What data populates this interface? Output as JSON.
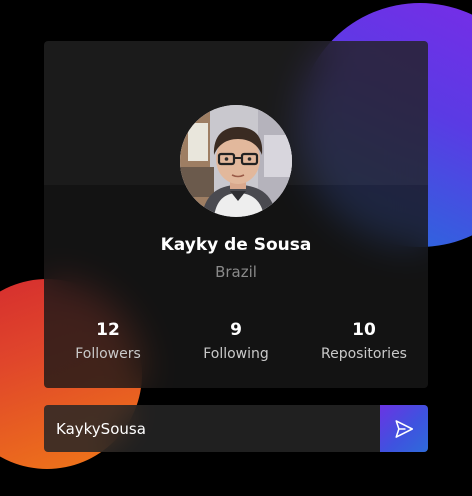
{
  "profile": {
    "name": "Kayky de Sousa",
    "location": "Brazil"
  },
  "stats": [
    {
      "value": "12",
      "label": "Followers"
    },
    {
      "value": "9",
      "label": "Following"
    },
    {
      "value": "10",
      "label": "Repositories"
    }
  ],
  "search": {
    "value": "KaykySousa"
  },
  "icons": {
    "send": "send-icon"
  },
  "colors": {
    "background": "#000000",
    "card": "#181818",
    "accent_purple": "#6a34e3",
    "accent_blue": "#2e6bda",
    "accent_orange": "#f07a17",
    "accent_red": "#d42a2f",
    "location_text": "#8a8a8a"
  }
}
